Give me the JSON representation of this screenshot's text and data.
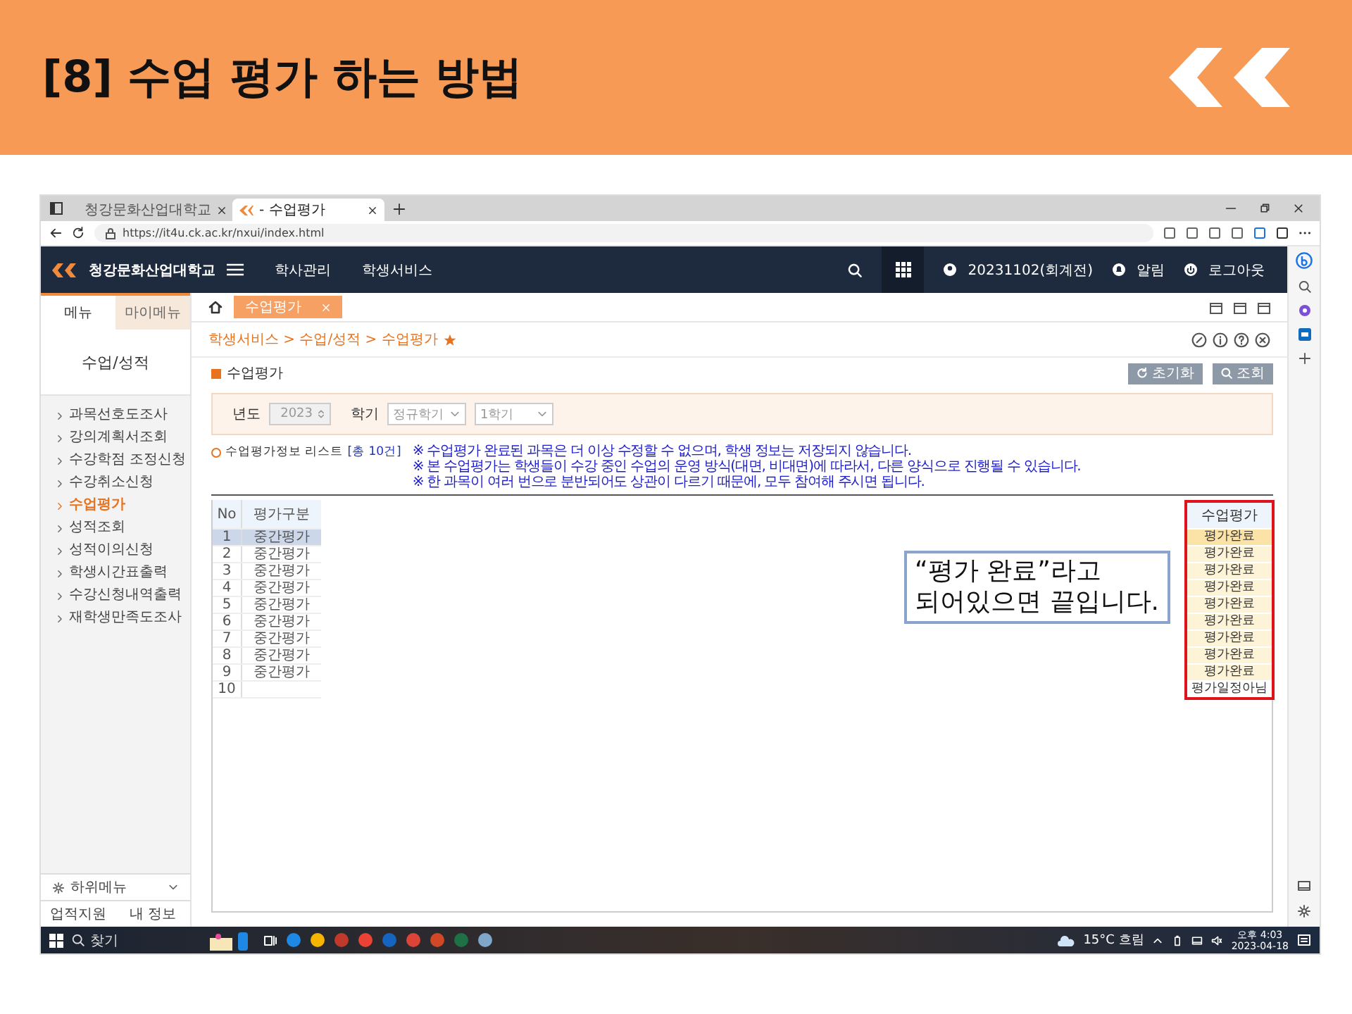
{
  "slide_title": "[8] 수업 평가 하는 방법",
  "browser": {
    "tabs": [
      {
        "label": "청강문화산업대학교",
        "selected": false
      },
      {
        "label": "- 수업평가",
        "selected": true
      }
    ],
    "url": "https://it4u.ck.ac.kr/nxui/index.html"
  },
  "nav": {
    "brand": "청강문화산업대학교",
    "menus": [
      "학사관리",
      "학생서비스"
    ],
    "user": "20231102(회계전)",
    "alert": "알림",
    "logout": "로그아웃"
  },
  "sidebar": {
    "tabs": [
      {
        "label": "메뉴",
        "selected": true
      },
      {
        "label": "마이메뉴",
        "selected": false
      }
    ],
    "heading": "수업/성적",
    "items": [
      {
        "label": "과목선호도조사",
        "selected": false
      },
      {
        "label": "강의계획서조회",
        "selected": false
      },
      {
        "label": "수강학점 조정신청",
        "selected": false
      },
      {
        "label": "수강취소신청",
        "selected": false
      },
      {
        "label": "수업평가",
        "selected": true
      },
      {
        "label": "성적조회",
        "selected": false
      },
      {
        "label": "성적이의신청",
        "selected": false
      },
      {
        "label": "학생시간표출력",
        "selected": false
      },
      {
        "label": "수강신청내역출력",
        "selected": false
      },
      {
        "label": "재학생만족도조사",
        "selected": false
      }
    ],
    "submenu": "하위메뉴",
    "links": [
      "업적지원",
      "내 정보"
    ]
  },
  "content": {
    "open_tab": "수업평가",
    "breadcrumb": "학생서비스 > 수업/성적 > 수업평가",
    "section_title": "수업평가",
    "buttons": [
      "초기화",
      "조회"
    ],
    "filters": {
      "year_label": "년도",
      "year": "2023",
      "term_label": "학기",
      "selects": [
        "정규학기",
        "1학기"
      ]
    },
    "list_title": "수업평가정보 리스트",
    "count": "[총 10건]",
    "notes": [
      "※ 수업평가 완료된 과목은 더 이상 수정할 수 없으며, 학생 정보는 저장되지 않습니다.",
      "※ 본 수업평가는 학생들이 수강 중인 수업의 운영 방식(대면, 비대면)에 따라서, 다른 양식으로 진행될 수 있습니다.",
      "※ 한 과목이 여러 번으로 분반되어도 상관이 다르기 때문에, 모두 참여해 주시면 됩니다."
    ],
    "table": {
      "columns": [
        "No",
        "평가구분"
      ],
      "status_column": "수업평가",
      "rows": [
        {
          "no": "1",
          "type": "중간평가",
          "status": "평가완료",
          "done": true,
          "selected": true
        },
        {
          "no": "2",
          "type": "중간평가",
          "status": "평가완료",
          "done": true,
          "selected": false
        },
        {
          "no": "3",
          "type": "중간평가",
          "status": "평가완료",
          "done": true,
          "selected": false
        },
        {
          "no": "4",
          "type": "중간평가",
          "status": "평가완료",
          "done": true,
          "selected": false
        },
        {
          "no": "5",
          "type": "중간평가",
          "status": "평가완료",
          "done": true,
          "selected": false
        },
        {
          "no": "6",
          "type": "중간평가",
          "status": "평가완료",
          "done": true,
          "selected": false
        },
        {
          "no": "7",
          "type": "중간평가",
          "status": "평가완료",
          "done": true,
          "selected": false
        },
        {
          "no": "8",
          "type": "중간평가",
          "status": "평가완료",
          "done": true,
          "selected": false
        },
        {
          "no": "9",
          "type": "중간평가",
          "status": "평가완료",
          "done": true,
          "selected": false
        },
        {
          "no": "10",
          "status": "평가일정아님",
          "done": false,
          "selected": false
        }
      ]
    },
    "callout": [
      "“평가 완료”라고",
      "되어있으면 끝입니다."
    ]
  },
  "taskbar": {
    "search": "찾기",
    "weather": "15°C 흐림",
    "time": "오후 4:03",
    "date": "2023-04-18"
  }
}
